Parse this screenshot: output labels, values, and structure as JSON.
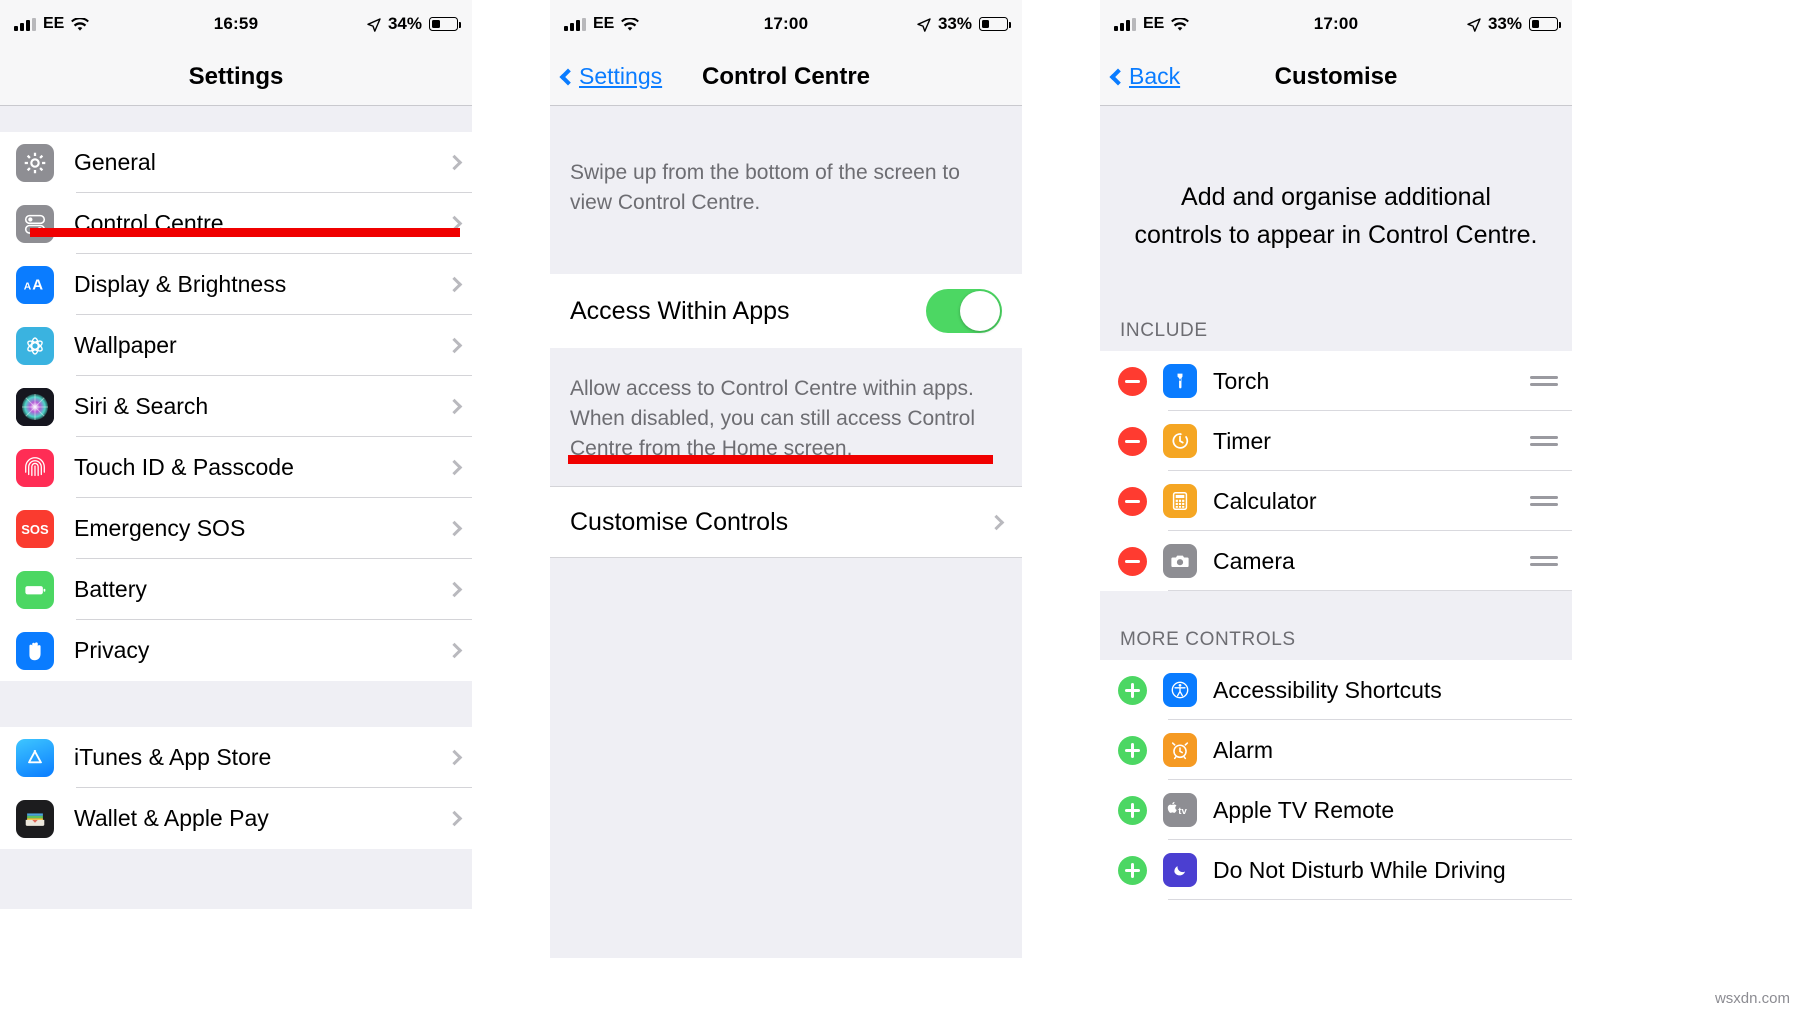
{
  "panels": [
    {
      "status": {
        "carrier": "EE",
        "time": "16:59",
        "battery_pct": "34%",
        "battery_level": 34
      },
      "nav": {
        "title": "Settings",
        "back": null
      },
      "items_group1": [
        {
          "label": "General",
          "icon": "gear-icon"
        },
        {
          "label": "Control Centre",
          "icon": "control-centre-icon"
        },
        {
          "label": "Display & Brightness",
          "icon": "display-brightness-icon"
        },
        {
          "label": "Wallpaper",
          "icon": "wallpaper-icon"
        },
        {
          "label": "Siri & Search",
          "icon": "siri-icon"
        },
        {
          "label": "Touch ID & Passcode",
          "icon": "touch-id-icon"
        },
        {
          "label": "Emergency SOS",
          "icon": "emergency-sos-icon"
        },
        {
          "label": "Battery",
          "icon": "battery-icon"
        },
        {
          "label": "Privacy",
          "icon": "privacy-hand-icon"
        }
      ],
      "items_group2": [
        {
          "label": "iTunes & App Store",
          "icon": "app-store-icon"
        },
        {
          "label": "Wallet & Apple Pay",
          "icon": "wallet-icon"
        }
      ]
    },
    {
      "status": {
        "carrier": "EE",
        "time": "17:00",
        "battery_pct": "33%",
        "battery_level": 33
      },
      "nav": {
        "title": "Control Centre",
        "back": "Settings"
      },
      "footnote_top": "Swipe up from the bottom of the screen to view Control Centre.",
      "toggle_row": {
        "label": "Access Within Apps",
        "state": "on"
      },
      "footnote_mid": "Allow access to Control Centre within apps. When disabled, you can still access Control Centre from the Home screen.",
      "link_row": {
        "label": "Customise Controls"
      }
    },
    {
      "status": {
        "carrier": "EE",
        "time": "17:00",
        "battery_pct": "33%",
        "battery_level": 33
      },
      "nav": {
        "title": "Customise",
        "back": "Back"
      },
      "blurb": "Add and organise additional controls to appear in Control Centre.",
      "include_header": "INCLUDE",
      "include": [
        {
          "label": "Torch",
          "icon": "torch-icon",
          "action": "remove"
        },
        {
          "label": "Timer",
          "icon": "timer-icon",
          "action": "remove"
        },
        {
          "label": "Calculator",
          "icon": "calculator-icon",
          "action": "remove"
        },
        {
          "label": "Camera",
          "icon": "camera-icon",
          "action": "remove"
        }
      ],
      "more_header": "MORE CONTROLS",
      "more": [
        {
          "label": "Accessibility Shortcuts",
          "icon": "accessibility-icon",
          "action": "add"
        },
        {
          "label": "Alarm",
          "icon": "alarm-icon",
          "action": "add"
        },
        {
          "label": "Apple TV Remote",
          "icon": "apple-tv-remote-icon",
          "action": "add"
        },
        {
          "label": "Do Not Disturb While Driving",
          "icon": "dnd-driving-icon",
          "action": "add"
        }
      ]
    }
  ],
  "annotations": {
    "accent_red": "#f00000",
    "highlight_1": "Control Centre",
    "highlight_2": "Customise Controls"
  },
  "watermark": "wsxdn.com"
}
